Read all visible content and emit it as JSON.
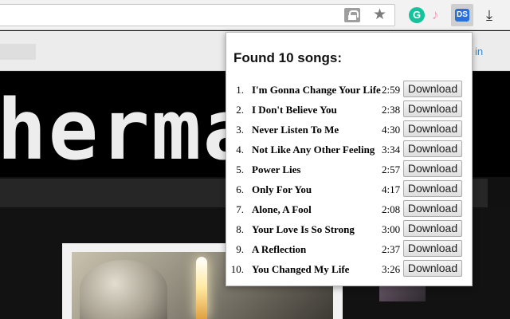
{
  "browser": {
    "toolbar_icons": [
      "lock-icon",
      "star-icon",
      "grammarly-icon",
      "music-note-icon",
      "extension-icon",
      "download-arrow-icon"
    ],
    "extension_g_label": "G",
    "extension_active_label": "DS"
  },
  "page": {
    "header_link": "in",
    "banner_text": "herma"
  },
  "popup": {
    "title": "Found 10 songs:",
    "download_label": "Download",
    "songs": [
      {
        "num": "1.",
        "title": "I'm Gonna Change Your Life",
        "duration": "2:59"
      },
      {
        "num": "2.",
        "title": "I Don't Believe You",
        "duration": "2:38"
      },
      {
        "num": "3.",
        "title": "Never Listen To Me",
        "duration": "4:30"
      },
      {
        "num": "4.",
        "title": "Not Like Any Other Feeling",
        "duration": "3:34"
      },
      {
        "num": "5.",
        "title": "Power Lies",
        "duration": "2:57"
      },
      {
        "num": "6.",
        "title": "Only For You",
        "duration": "4:17"
      },
      {
        "num": "7.",
        "title": "Alone, A Fool",
        "duration": "2:08"
      },
      {
        "num": "8.",
        "title": "Your Love Is So Strong",
        "duration": "3:00"
      },
      {
        "num": "9.",
        "title": "A Reflection",
        "duration": "2:37"
      },
      {
        "num": "10.",
        "title": "You Changed My Life",
        "duration": "3:26"
      }
    ]
  }
}
